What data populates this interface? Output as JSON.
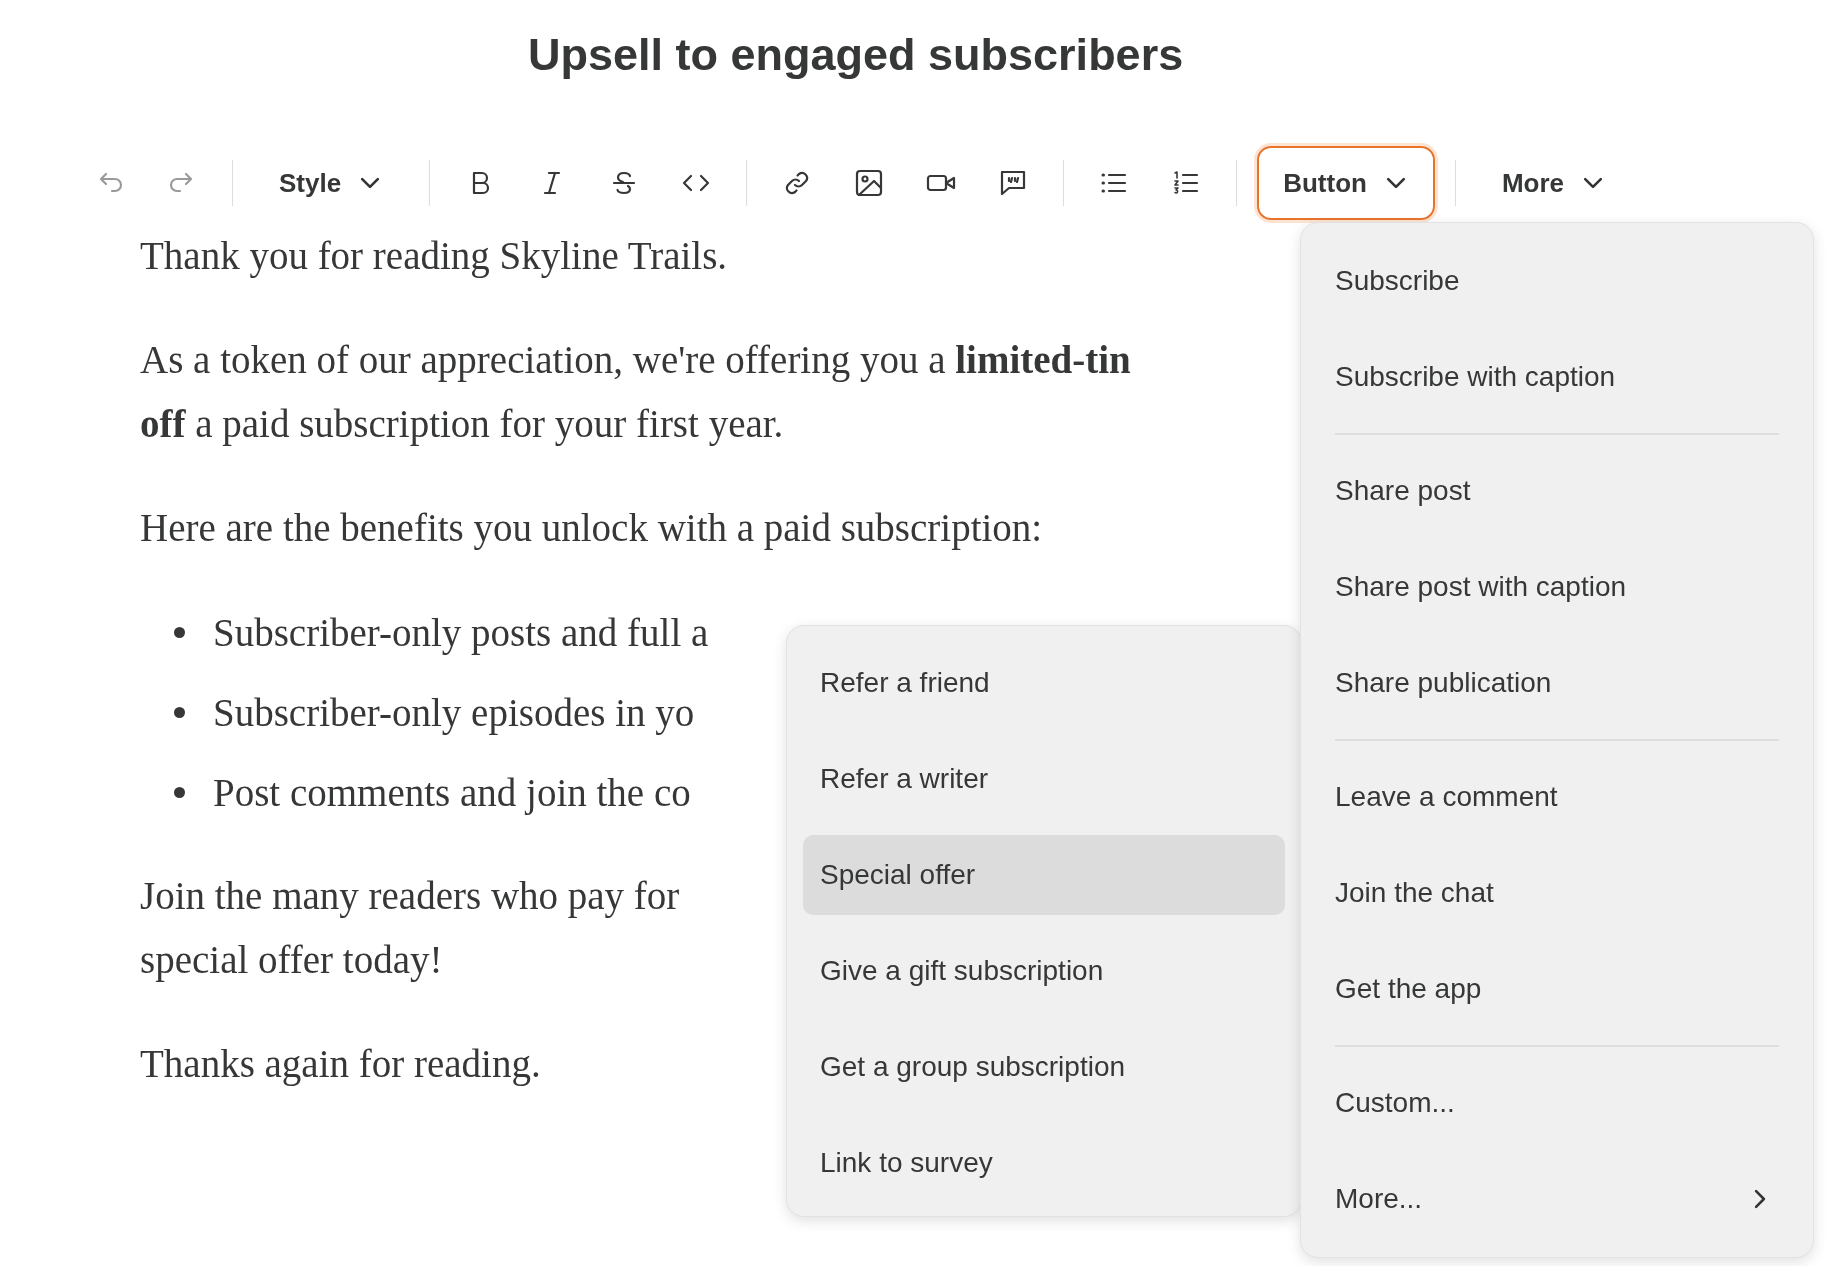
{
  "title": "Upsell to engaged subscribers",
  "toolbar": [
    {
      "kind": "undo",
      "disabled": true
    },
    {
      "kind": "redo",
      "disabled": true
    },
    {
      "kind": "divider"
    },
    {
      "kind": "dropdown",
      "label": "Style",
      "active": false
    },
    {
      "kind": "divider"
    },
    {
      "kind": "bold"
    },
    {
      "kind": "italic"
    },
    {
      "kind": "strikethrough"
    },
    {
      "kind": "code"
    },
    {
      "kind": "divider"
    },
    {
      "kind": "link"
    },
    {
      "kind": "image"
    },
    {
      "kind": "video"
    },
    {
      "kind": "comment"
    },
    {
      "kind": "divider"
    },
    {
      "kind": "bullet-list"
    },
    {
      "kind": "numbered-list"
    },
    {
      "kind": "divider"
    },
    {
      "kind": "dropdown",
      "label": "Button",
      "active": true
    },
    {
      "kind": "divider"
    },
    {
      "kind": "dropdown",
      "label": "More",
      "active": false
    }
  ],
  "content": [
    {
      "kind": "paragraph",
      "lines": [
        "Thank you for reading Skyline Trails."
      ]
    },
    {
      "kind": "paragraph",
      "lines": [
        "As a token of our appreciation, we're offering you a **limited-tin**",
        "**off** a paid subscription for your first year."
      ]
    },
    {
      "kind": "paragraph",
      "lines": [
        "Here are the benefits you unlock with a paid subscription:"
      ]
    },
    {
      "kind": "bullets",
      "items": [
        "Subscriber-only posts and full a",
        "Subscriber-only episodes in yo",
        "Post comments and join the co"
      ]
    },
    {
      "kind": "paragraph",
      "lines": [
        "Join the many readers who pay for",
        "special offer today!"
      ]
    },
    {
      "kind": "paragraph",
      "lines": [
        "Thanks again for reading."
      ]
    }
  ],
  "button_menu": {
    "sections": [
      {
        "items": [
          {
            "label": "Subscribe",
            "kind": "action"
          },
          {
            "label": "Subscribe with caption",
            "kind": "action"
          }
        ]
      },
      {
        "items": [
          {
            "label": "Share post",
            "kind": "action"
          },
          {
            "label": "Share post with caption",
            "kind": "action"
          },
          {
            "label": "Share publication",
            "kind": "action"
          }
        ]
      },
      {
        "items": [
          {
            "label": "Leave a comment",
            "kind": "action"
          },
          {
            "label": "Join the chat",
            "kind": "action"
          },
          {
            "label": "Get the app",
            "kind": "action"
          }
        ]
      },
      {
        "items": [
          {
            "label": "Custom...",
            "kind": "action"
          },
          {
            "label": "More...",
            "kind": "submenu"
          }
        ]
      }
    ]
  },
  "submenu": {
    "items": [
      {
        "label": "Refer a friend",
        "selected": false
      },
      {
        "label": "Refer a writer",
        "selected": false
      },
      {
        "label": "Special offer",
        "selected": true
      },
      {
        "label": "Give a gift subscription",
        "selected": false
      },
      {
        "label": "Get a group subscription",
        "selected": false
      },
      {
        "label": "Link to survey",
        "selected": false
      }
    ]
  }
}
